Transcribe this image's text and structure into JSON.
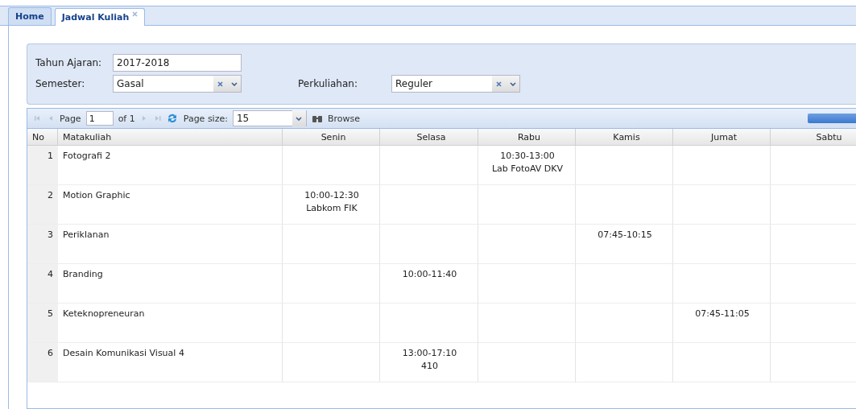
{
  "tabs": [
    {
      "label": "Home",
      "selected": false,
      "closable": false
    },
    {
      "label": "Jadwal Kuliah",
      "selected": true,
      "closable": true
    }
  ],
  "filters": {
    "tahun_ajaran": {
      "label": "Tahun Ajaran:",
      "value": "2017-2018"
    },
    "semester": {
      "label": "Semester:",
      "value": "Gasal"
    },
    "perkuliahan": {
      "label": "Perkuliahan:",
      "value": "Reguler"
    }
  },
  "pager": {
    "page_label": "Page",
    "page": "1",
    "of": "of 1",
    "page_size_label": "Page size:",
    "page_size": "15",
    "browse": "Browse"
  },
  "table": {
    "columns": [
      "No",
      "Matakuliah",
      "Senin",
      "Selasa",
      "Rabu",
      "Kamis",
      "Jumat",
      "Sabtu"
    ],
    "rows": [
      {
        "no": "1",
        "matakuliah": "Fotografi 2",
        "rabu": [
          "10:30-13:00",
          "Lab FotoAV DKV"
        ]
      },
      {
        "no": "2",
        "matakuliah": "Motion Graphic",
        "senin": [
          "10:00-12:30",
          "Labkom FIK"
        ]
      },
      {
        "no": "3",
        "matakuliah": "Periklanan",
        "kamis": [
          "07:45-10:15"
        ]
      },
      {
        "no": "4",
        "matakuliah": "Branding",
        "selasa": [
          "10:00-11:40"
        ]
      },
      {
        "no": "5",
        "matakuliah": "Keteknopreneuran",
        "jumat": [
          "07:45-11:05"
        ]
      },
      {
        "no": "6",
        "matakuliah": "Desain Komunikasi Visual 4",
        "selasa": [
          "13:00-17:10",
          "410"
        ]
      }
    ]
  }
}
